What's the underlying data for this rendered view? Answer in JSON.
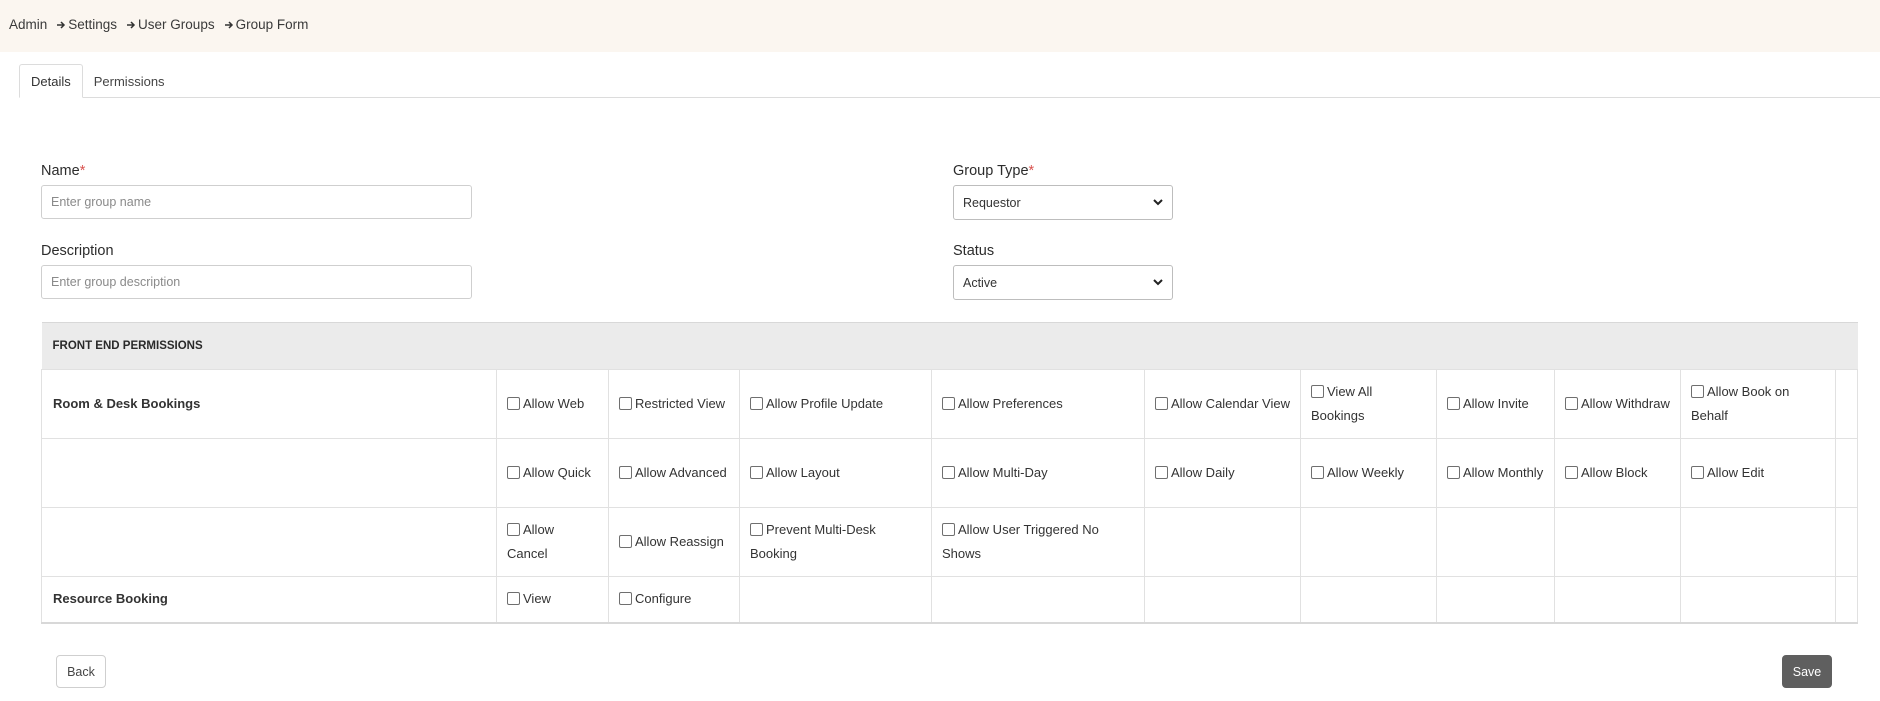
{
  "breadcrumb": [
    "Admin",
    "Settings",
    "User Groups",
    "Group Form"
  ],
  "tabs": [
    {
      "label": "Details",
      "active": true
    },
    {
      "label": "Permissions",
      "active": false
    }
  ],
  "form": {
    "name": {
      "label": "Name",
      "required_mark": "*",
      "value": "",
      "placeholder": "Enter group name"
    },
    "description": {
      "label": "Description",
      "value": "",
      "placeholder": "Enter group description"
    },
    "group_type": {
      "label": "Group Type",
      "required_mark": "*",
      "selected": "Requestor"
    },
    "status": {
      "label": "Status",
      "selected": "Active"
    }
  },
  "permissions": {
    "section_title": "FRONT END PERMISSIONS",
    "rows": [
      {
        "label": "Room & Desk Bookings",
        "options": [
          "Allow Web",
          "Restricted View",
          "Allow Profile Update",
          "Allow Preferences",
          "Allow Calendar View",
          "View All Bookings",
          "Allow Invite",
          "Allow Withdraw",
          "Allow Book on Behalf"
        ]
      },
      {
        "label": "",
        "options": [
          "Allow Quick",
          "Allow Advanced",
          "Allow Layout",
          "Allow Multi-Day",
          "Allow Daily",
          "Allow Weekly",
          "Allow Monthly",
          "Allow Block",
          "Allow Edit"
        ]
      },
      {
        "label": "",
        "options": [
          "Allow Cancel",
          "Allow Reassign",
          "Prevent Multi-Desk Booking",
          "Allow User Triggered No Shows"
        ]
      },
      {
        "label": "Resource Booking",
        "options": [
          "View",
          "Configure"
        ]
      }
    ]
  },
  "buttons": {
    "back": "Back",
    "save": "Save"
  },
  "colors": {
    "topbar_bg": "#fbf6f0",
    "section_header_bg": "#ebebeb",
    "save_bg": "#5f5f5f",
    "required": "#d9534f"
  },
  "icons": {
    "breadcrumb_separator": "arrow-right-icon",
    "select_caret": "chevron-down-icon"
  }
}
